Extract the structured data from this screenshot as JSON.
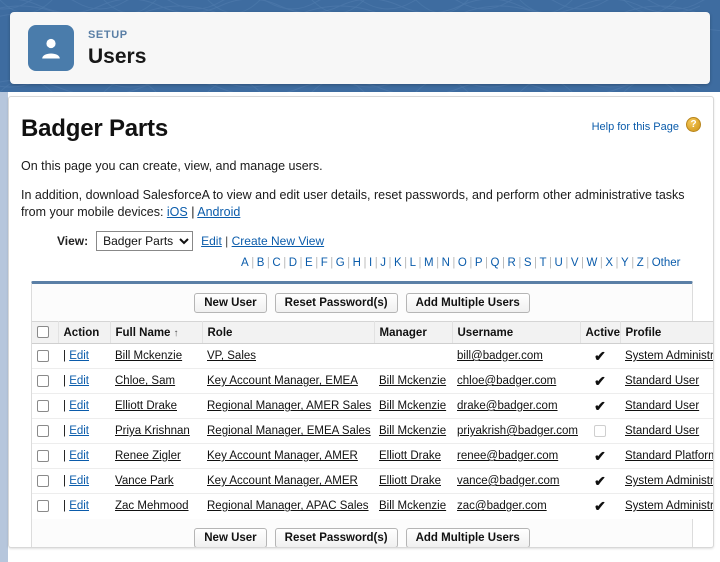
{
  "header": {
    "eyebrow": "SETUP",
    "title": "Users",
    "icon": "person-icon"
  },
  "page": {
    "title": "Badger Parts",
    "help_label": "Help for this Page",
    "help_icon_glyph": "?",
    "intro_line_1": "On this page you can create, view, and manage users.",
    "intro_line_2_prefix": "In addition, download SalesforceA to view and edit user details, reset passwords, and perform other administrative tasks from your mobile devices: ",
    "intro_ios": "iOS",
    "intro_separator": " | ",
    "intro_android": "Android"
  },
  "view": {
    "label": "View:",
    "selected": "Badger Parts",
    "options": [
      "Badger Parts"
    ],
    "edit_label": "Edit",
    "separator": "|",
    "create_label": "Create New View"
  },
  "alphabet": [
    "A",
    "B",
    "C",
    "D",
    "E",
    "F",
    "G",
    "H",
    "I",
    "J",
    "K",
    "L",
    "M",
    "N",
    "O",
    "P",
    "Q",
    "R",
    "S",
    "T",
    "U",
    "V",
    "W",
    "X",
    "Y",
    "Z",
    "Other"
  ],
  "buttons": {
    "new_user": "New User",
    "reset_passwords": "Reset Password(s)",
    "add_multiple": "Add Multiple Users"
  },
  "table": {
    "columns": [
      "Action",
      "Full Name",
      "Role",
      "Manager",
      "Username",
      "Active",
      "Profile"
    ],
    "sort_column": "Full Name",
    "sort_arrow": "↑",
    "edit_label": "Edit",
    "action_separator": "|",
    "check_glyph": "✔",
    "rows": [
      {
        "full_name": "Bill Mckenzie",
        "role": "VP, Sales",
        "manager": "",
        "username": "bill@badger.com",
        "active": true,
        "profile": "System Administrator"
      },
      {
        "full_name": "Chloe, Sam",
        "role": "Key Account Manager, EMEA",
        "manager": "Bill Mckenzie",
        "username": "chloe@badger.com",
        "active": true,
        "profile": "Standard User"
      },
      {
        "full_name": "Elliott Drake",
        "role": "Regional Manager, AMER Sales",
        "manager": "Bill Mckenzie",
        "username": "drake@badger.com",
        "active": true,
        "profile": "Standard User"
      },
      {
        "full_name": "Priya Krishnan",
        "role": "Regional Manager, EMEA Sales",
        "manager": "Bill Mckenzie",
        "username": "priyakrish@badger.com",
        "active": false,
        "profile": "Standard User"
      },
      {
        "full_name": "Renee Zigler",
        "role": "Key Account Manager, AMER",
        "manager": "Elliott Drake",
        "username": "renee@badger.com",
        "active": true,
        "profile": "Standard Platform User"
      },
      {
        "full_name": "Vance Park",
        "role": "Key Account Manager, AMER",
        "manager": "Elliott Drake",
        "username": "vance@badger.com",
        "active": true,
        "profile": "System Administrator"
      },
      {
        "full_name": "Zac Mehmood",
        "role": "Regional Manager, APAC Sales",
        "manager": "Bill Mckenzie",
        "username": "zac@badger.com",
        "active": true,
        "profile": "System Administrator"
      }
    ]
  },
  "sidebar_toggle": {
    "name": "collapse-sidebar-tab",
    "icon": "triangle-left-icon"
  },
  "colors": {
    "banner_blue": "#3e6ca0",
    "badge_blue": "#4a7cab",
    "link_blue": "#0b5cab",
    "help_gold": "#d9a227",
    "panel_top_border": "#5a7fa6"
  }
}
